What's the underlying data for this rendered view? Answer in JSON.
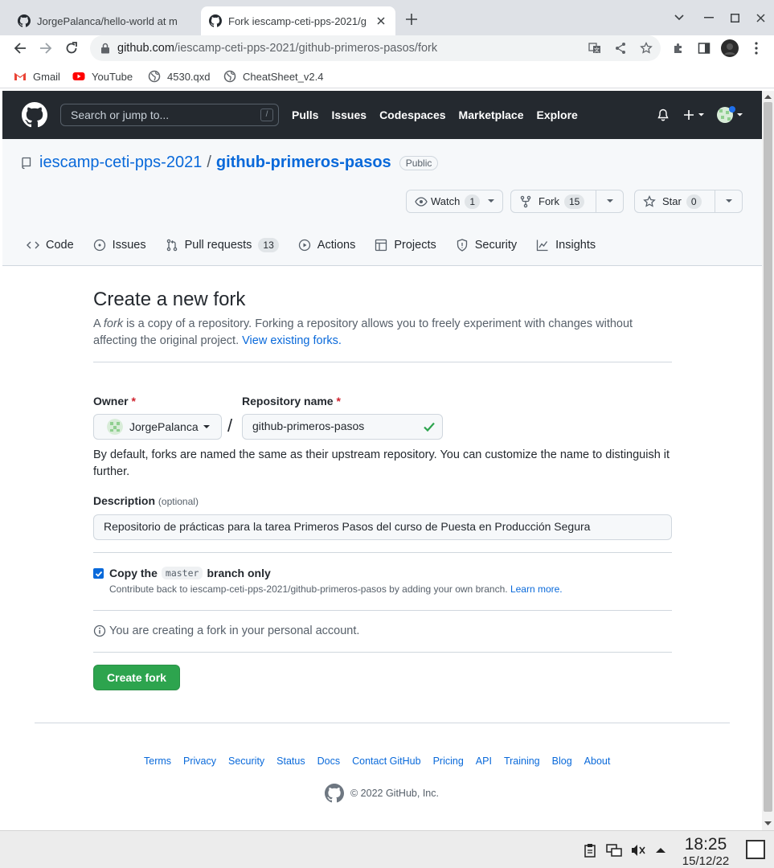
{
  "browser": {
    "tabs": [
      {
        "title": "JorgePalanca/hello-world at m",
        "active": false
      },
      {
        "title": "Fork iescamp-ceti-pps-2021/g",
        "active": true
      }
    ],
    "url_host": "github.com",
    "url_path": "/iescamp-ceti-pps-2021/github-primeros-pasos/fork",
    "bookmarks": [
      {
        "label": "Gmail",
        "icon": "gmail-icon"
      },
      {
        "label": "YouTube",
        "icon": "youtube-icon"
      },
      {
        "label": "4530.qxd",
        "icon": "globe-icon"
      },
      {
        "label": "CheatSheet_v2.4",
        "icon": "globe-icon"
      }
    ]
  },
  "github": {
    "search_placeholder": "Search or jump to...",
    "search_shortcut": "/",
    "nav": [
      "Pulls",
      "Issues",
      "Codespaces",
      "Marketplace",
      "Explore"
    ]
  },
  "repo": {
    "owner": "iescamp-ceti-pps-2021",
    "separator": "/",
    "name": "github-primeros-pasos",
    "visibility": "Public",
    "watch_label": "Watch",
    "watch_count": "1",
    "fork_label": "Fork",
    "fork_count": "15",
    "star_label": "Star",
    "star_count": "0",
    "tabs": [
      {
        "label": "Code",
        "icon": "code-icon"
      },
      {
        "label": "Issues",
        "icon": "issue-icon"
      },
      {
        "label": "Pull requests",
        "icon": "pull-request-icon",
        "count": "13"
      },
      {
        "label": "Actions",
        "icon": "play-icon"
      },
      {
        "label": "Projects",
        "icon": "table-icon"
      },
      {
        "label": "Security",
        "icon": "shield-icon"
      },
      {
        "label": "Insights",
        "icon": "graph-icon"
      }
    ]
  },
  "fork_form": {
    "title": "Create a new fork",
    "intro_prefix": "A ",
    "intro_em": "fork",
    "intro_rest": " is a copy of a repository. Forking a repository allows you to freely experiment with changes without affecting the original project. ",
    "intro_link": "View existing forks.",
    "owner_label": "Owner",
    "required_mark": "*",
    "owner_value": "JorgePalanca",
    "slash": "/",
    "repo_name_label": "Repository name",
    "repo_name_value": "github-primeros-pasos",
    "help_text": "By default, forks are named the same as their upstream repository. You can customize the name to distinguish it further.",
    "description_label": "Description",
    "description_optional": "(optional)",
    "description_value": "Repositorio de prácticas para la tarea Primeros Pasos del curso de Puesta en Producción Segura",
    "copy_checked": true,
    "copy_prefix": "Copy the",
    "copy_branch": "master",
    "copy_suffix": "branch only",
    "copy_note": "Contribute back to iescamp-ceti-pps-2021/github-primeros-pasos by adding your own branch.",
    "copy_note_link": "Learn more.",
    "info_text": "You are creating a fork in your personal account.",
    "submit_label": "Create fork"
  },
  "footer": {
    "links": [
      "Terms",
      "Privacy",
      "Security",
      "Status",
      "Docs",
      "Contact GitHub",
      "Pricing",
      "API",
      "Training",
      "Blog",
      "About"
    ],
    "copyright": "© 2022 GitHub, Inc."
  },
  "taskbar": {
    "time": "18:25",
    "date": "15/12/22"
  },
  "colors": {
    "header_bg": "#24292f",
    "link": "#0969da",
    "primary_button": "#2da44e",
    "required": "#cf222e"
  }
}
